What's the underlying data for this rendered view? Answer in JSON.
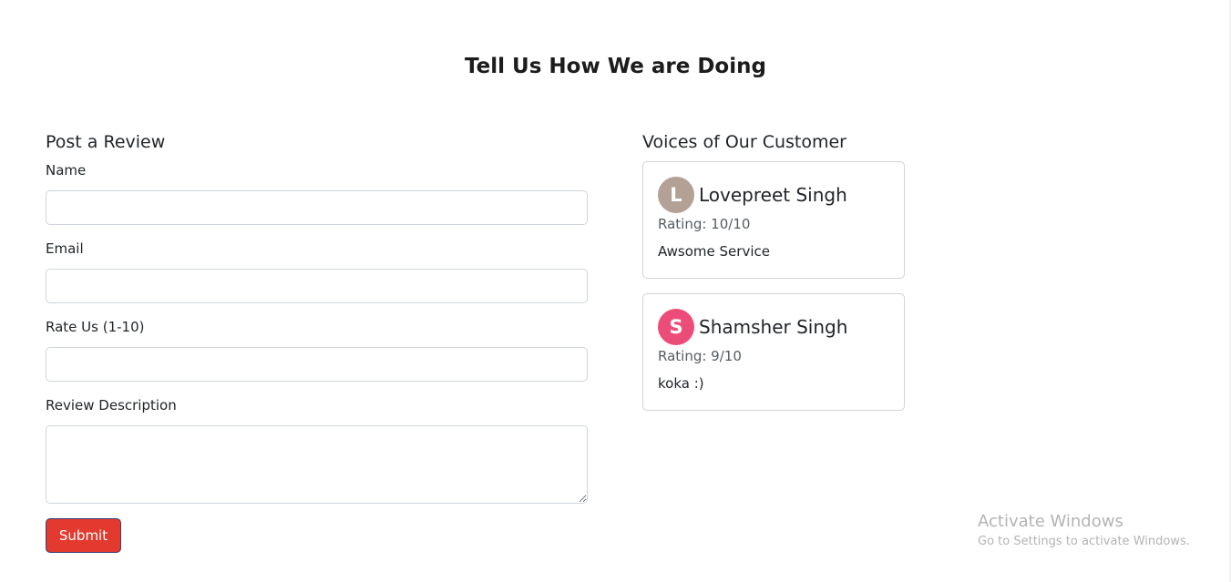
{
  "page": {
    "title": "Tell Us How We are Doing"
  },
  "form": {
    "heading": "Post a Review",
    "fields": [
      {
        "label": "Name",
        "value": "",
        "placeholder": ""
      },
      {
        "label": "Email",
        "value": "",
        "placeholder": ""
      },
      {
        "label": "Rate Us (1-10)",
        "value": "",
        "placeholder": ""
      },
      {
        "label": "Review Description",
        "value": "",
        "placeholder": ""
      }
    ],
    "submit_label": "Submit"
  },
  "reviews": {
    "heading": "Voices of Our Customer",
    "items": [
      {
        "initial": "L",
        "avatar_color": "#b3a195",
        "name": "Lovepreet Singh",
        "rating": "Rating: 10/10",
        "text": "Awsome Service"
      },
      {
        "initial": "S",
        "avatar_color": "#ec4d78",
        "name": "Shamsher Singh",
        "rating": "Rating: 9/10",
        "text": "koka :)"
      }
    ]
  },
  "watermark": {
    "title": "Activate Windows",
    "subtitle": "Go to Settings to activate Windows."
  },
  "colors": {
    "submit_bg": "#e23a2e",
    "card_border": "#d3d3d3",
    "input_border": "#ced4da"
  }
}
